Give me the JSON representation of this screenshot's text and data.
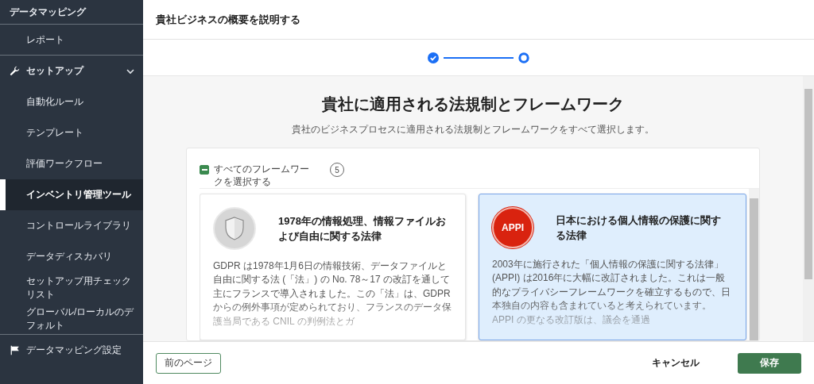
{
  "sidebar": {
    "items": [
      {
        "kind": "heading",
        "label": "データマッピング",
        "selected": false
      },
      {
        "kind": "item",
        "label": "レポート",
        "selected": false
      },
      {
        "kind": "group",
        "label": "セットアップ",
        "expanded": true,
        "selected": false,
        "children": [
          {
            "label": "自動化ルール",
            "selected": false
          },
          {
            "label": "テンプレート",
            "selected": false
          },
          {
            "label": "評価ワークフロー",
            "selected": false
          },
          {
            "label": "インベントリ管理ツール",
            "selected": true
          },
          {
            "label": "コントロールライブラリ",
            "selected": false
          },
          {
            "label": "データディスカバリ",
            "selected": false
          },
          {
            "label": "セットアップ用チェックリスト",
            "selected": false
          },
          {
            "label": "グローバル/ローカルのデフォルト",
            "selected": false
          }
        ]
      },
      {
        "kind": "group",
        "label": "データマッピング設定",
        "expanded": false,
        "selected": false
      }
    ]
  },
  "header": {
    "title": "貴社ビジネスの概要を説明する"
  },
  "stepper": {
    "steps": [
      {
        "done": true
      },
      {
        "done": false
      }
    ]
  },
  "content": {
    "title": "貴社に適用される法規制とフレームワーク",
    "subtitle": "貴社のビジネスプロセスに適用される法規制とフレームワークをすべて選択します。",
    "select_all": {
      "label": "すべてのフレームワークを選択する",
      "indeterminate": true,
      "count": "5"
    },
    "frameworks": [
      {
        "kind": "shield",
        "title": "1978年の情報処理、情報ファイルおよび自由に関する法律",
        "description": "GDPR は1978年1月6日の情報技術、データファイルと自由に関する法 (「法」) の No. 78～17 の改訂を通して主にフランスで導入されました。この「法」は、GDPR からの例外事項が定められており、フランスのデータ保護当局である CNIL の判例法とガ",
        "selected": false
      },
      {
        "kind": "badge",
        "badge": "APPI",
        "title": "日本における個人情報の保護に関する法律",
        "description": "2003年に施行された「個人情報の保護に関する法律」(APPI) は2016年に大幅に改訂されました。これは一般的なプライバシーフレームワークを確立するもので、日本独自の内容も含まれていると考えられています。APPI の更なる改訂版は、議会を通過",
        "selected": true
      }
    ]
  },
  "footer": {
    "back": "前のページ",
    "cancel": "キャンセル",
    "save": "保存"
  }
}
